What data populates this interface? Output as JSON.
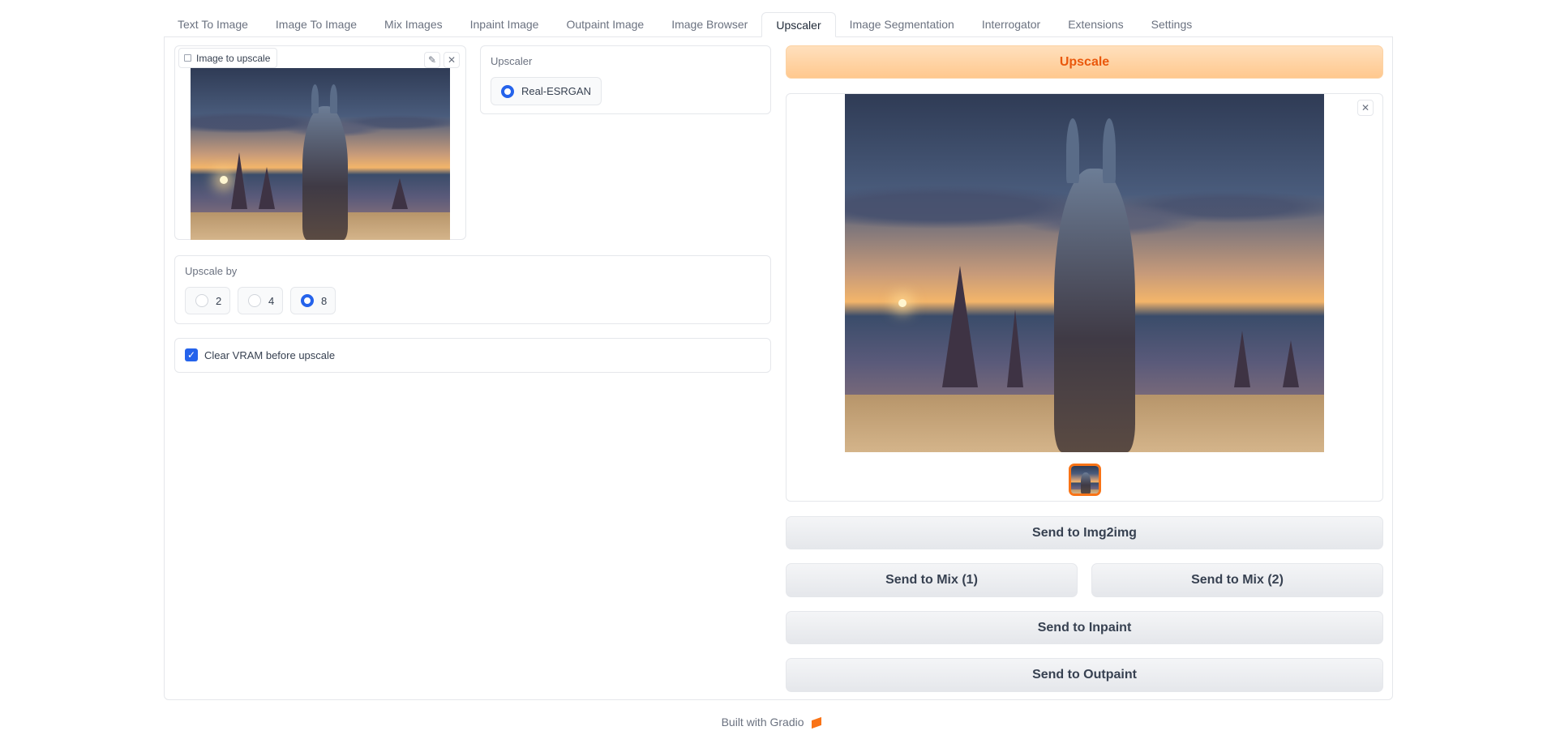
{
  "tabs": [
    "Text To Image",
    "Image To Image",
    "Mix Images",
    "Inpaint Image",
    "Outpaint Image",
    "Image Browser",
    "Upscaler",
    "Image Segmentation",
    "Interrogator",
    "Extensions",
    "Settings"
  ],
  "active_tab": "Upscaler",
  "input_image": {
    "label": "Image to upscale"
  },
  "upscaler": {
    "label": "Upscaler",
    "option": "Real-ESRGAN",
    "selected": true
  },
  "upscale_by": {
    "label": "Upscale by",
    "options": [
      "2",
      "4",
      "8"
    ],
    "selected": "8"
  },
  "clear_vram": {
    "label": "Clear VRAM before upscale",
    "checked": true
  },
  "actions": {
    "upscale": "Upscale",
    "send_img2img": "Send to Img2img",
    "send_mix1": "Send to Mix (1)",
    "send_mix2": "Send to Mix (2)",
    "send_inpaint": "Send to Inpaint",
    "send_outpaint": "Send to Outpaint"
  },
  "footer": {
    "text": "Built with Gradio"
  },
  "colors": {
    "primary_text": "#ea580c",
    "radio_accent": "#2563eb",
    "thumb_border": "#f97316"
  },
  "icons": {
    "image": "image-icon",
    "edit": "pencil-icon",
    "close": "close-icon",
    "gradio": "gradio-logo-icon"
  }
}
